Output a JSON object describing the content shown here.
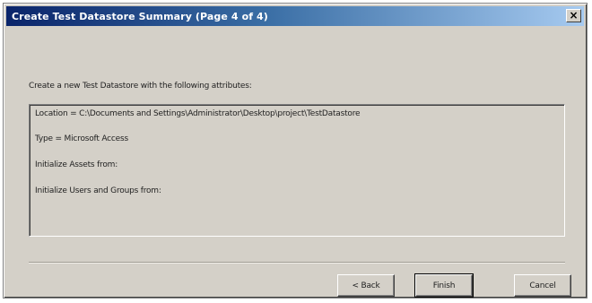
{
  "window": {
    "title": "Create Test Datastore Summary (Page 4 of 4)",
    "close_glyph": "×",
    "colors": {
      "titlebar_start": "#0a246a",
      "titlebar_end": "#a6caf0",
      "face": "#d4d0c8"
    }
  },
  "content": {
    "intro": "Create a new Test Datastore with the following attributes:",
    "attributes": [
      "Location = C:\\Documents and Settings\\Administrator\\Desktop\\project\\TestDatastore",
      "Type = Microsoft Access",
      "Initialize Assets from:",
      "Initialize Users and Groups from:"
    ]
  },
  "buttons": {
    "back": "< Back",
    "finish": "Finish",
    "cancel": "Cancel"
  }
}
